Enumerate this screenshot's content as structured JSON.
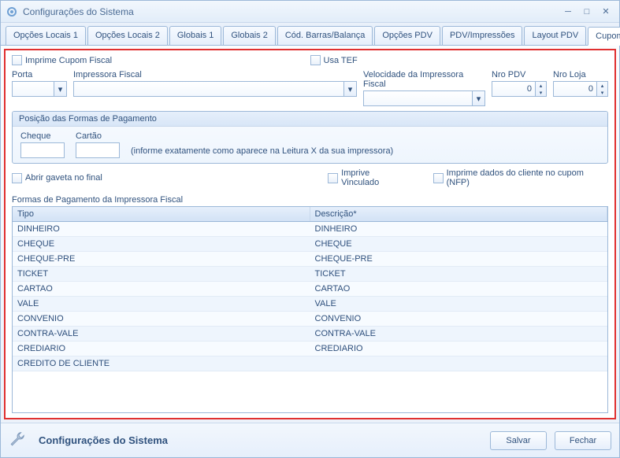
{
  "window": {
    "title": "Configurações do Sistema"
  },
  "tabs": [
    "Opções Locais 1",
    "Opções Locais 2",
    "Globais 1",
    "Globais 2",
    "Cód. Barras/Balança",
    "Opções PDV",
    "PDV/Impressões",
    "Layout PDV",
    "Cupom Fiscal"
  ],
  "active_tab": 8,
  "checks": {
    "imprime_cupom": "Imprime Cupom Fiscal",
    "usa_tef": "Usa TEF",
    "abrir_gaveta": "Abrir gaveta no final",
    "imprive_vinculado": "Imprive Vinculado",
    "imprime_dados_cliente": "Imprime dados do cliente no cupom (NFP)"
  },
  "fields": {
    "porta": {
      "label": "Porta",
      "value": ""
    },
    "impressora_fiscal": {
      "label": "Impressora Fiscal",
      "value": ""
    },
    "velocidade": {
      "label": "Velocidade da Impressora Fiscal",
      "value": ""
    },
    "nro_pdv": {
      "label": "Nro PDV",
      "value": "0"
    },
    "nro_loja": {
      "label": "Nro Loja",
      "value": "0"
    }
  },
  "group_posicao": {
    "title": "Posição das Formas de Pagamento",
    "cheque": "Cheque",
    "cartao": "Cartão",
    "hint": "(informe exatamente como aparece na Leitura X da sua impressora)"
  },
  "table": {
    "title": "Formas de Pagamento da Impressora Fiscal",
    "headers": [
      "Tipo",
      "Descrição*"
    ],
    "rows": [
      [
        "DINHEIRO",
        "DINHEIRO"
      ],
      [
        "CHEQUE",
        "CHEQUE"
      ],
      [
        "CHEQUE-PRE",
        "CHEQUE-PRE"
      ],
      [
        "TICKET",
        "TICKET"
      ],
      [
        "CARTAO",
        "CARTAO"
      ],
      [
        "VALE",
        "VALE"
      ],
      [
        "CONVENIO",
        "CONVENIO"
      ],
      [
        "CONTRA-VALE",
        "CONTRA-VALE"
      ],
      [
        "CREDIARIO",
        "CREDIARIO"
      ],
      [
        "CREDITO DE CLIENTE",
        ""
      ]
    ]
  },
  "footer": {
    "title": "Configurações do Sistema",
    "save": "Salvar",
    "close": "Fechar"
  }
}
